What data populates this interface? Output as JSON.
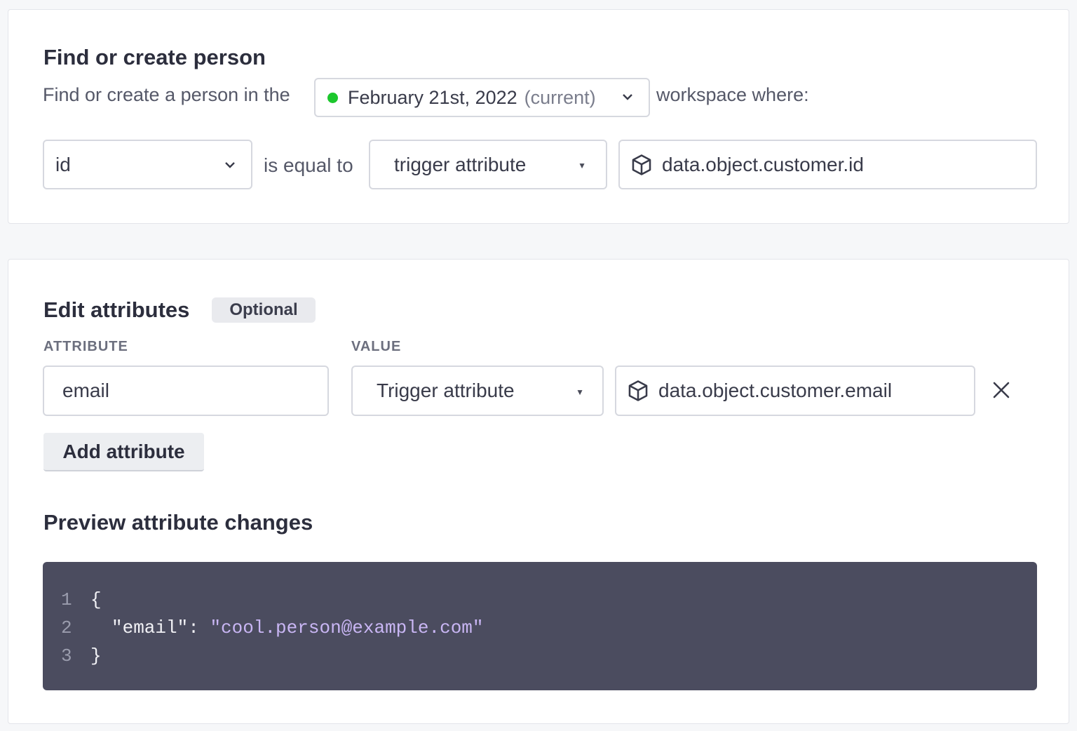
{
  "find_section": {
    "title": "Find or create person",
    "sentence_prefix": "Find or create a person in the",
    "sentence_suffix": "workspace where:",
    "workspace_select": {
      "date": "February 21st, 2022",
      "tag": "(current)",
      "status_color": "#1cc72d"
    },
    "condition": {
      "field_value": "id",
      "operator_text": "is equal to",
      "source_value": "trigger attribute",
      "path_value": "data.object.customer.id",
      "path_icon": "cube-icon"
    }
  },
  "edit_section": {
    "title": "Edit attributes",
    "optional_badge": "Optional",
    "attribute_header": "ATTRIBUTE",
    "value_header": "VALUE",
    "row": {
      "attribute_value": "email",
      "source_value": "Trigger attribute",
      "path_value": "data.object.customer.email",
      "path_icon": "cube-icon",
      "remove_icon": "close-icon"
    },
    "add_button_label": "Add attribute"
  },
  "preview": {
    "title": "Preview attribute changes",
    "line_numbers": [
      "1",
      "2",
      "3"
    ],
    "open_brace": "{",
    "key": "\"email\"",
    "colon": ": ",
    "value": "\"cool.person@example.com\"",
    "close_brace": "}"
  }
}
